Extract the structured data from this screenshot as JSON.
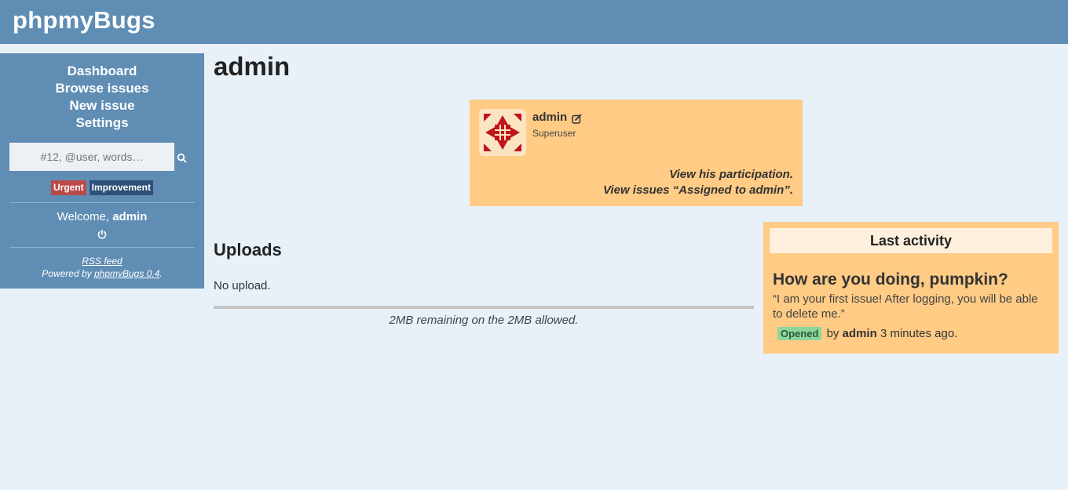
{
  "app": {
    "brand": "phpmyBugs"
  },
  "sidebar": {
    "nav": [
      "Dashboard",
      "Browse issues",
      "New issue",
      "Settings"
    ],
    "search_placeholder": "#12, @user, words…",
    "tags": [
      "Urgent",
      "Improvement"
    ],
    "welcome_prefix": "Welcome,",
    "welcome_user": "admin",
    "rss": "RSS feed",
    "powered_prefix": "Powered by",
    "powered_link": "phpmyBugs 0.4",
    "powered_suffix": "."
  },
  "page": {
    "title": "admin"
  },
  "user_card": {
    "name": "admin",
    "role": "Superuser",
    "link_participation": "View his participation.",
    "link_assigned": "View issues “Assigned to admin”."
  },
  "uploads": {
    "heading": "Uploads",
    "empty": "No upload.",
    "quota_text": "2MB remaining on the 2MB allowed.",
    "quota_used_fraction": 0
  },
  "activity": {
    "heading": "Last activity",
    "issue_title": "How are you doing, pumpkin?",
    "issue_quote": "“I am your first issue! After logging, you will be able to delete me.”",
    "status": "Opened",
    "by_prefix": "by",
    "by_user": "admin",
    "time": "3 minutes ago."
  },
  "colors": {
    "header": "#5f8db4",
    "card": "#ffcb85",
    "urgent": "#b94a48",
    "improvement": "#2e5078",
    "opened": "#8ed69c"
  }
}
